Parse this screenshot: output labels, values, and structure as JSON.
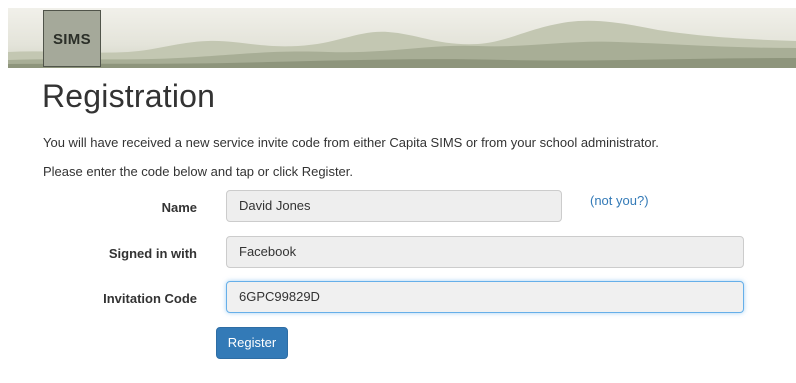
{
  "header": {
    "logo_text": "SIMS"
  },
  "page": {
    "title": "Registration",
    "intro_line1": "You will have received a new service invite code from either Capita SIMS or from your school administrator.",
    "intro_line2": "Please enter the code below and tap or click Register."
  },
  "form": {
    "name_label": "Name",
    "name_value": "David Jones",
    "not_you_link": "(not you?)",
    "signed_in_label": "Signed in with",
    "signed_in_value": "Facebook",
    "invitation_label": "Invitation Code",
    "invitation_value": "6GPC99829D",
    "register_label": "Register"
  },
  "colors": {
    "link": "#337ab7",
    "button": "#337ab7",
    "focus": "#66afe9"
  }
}
